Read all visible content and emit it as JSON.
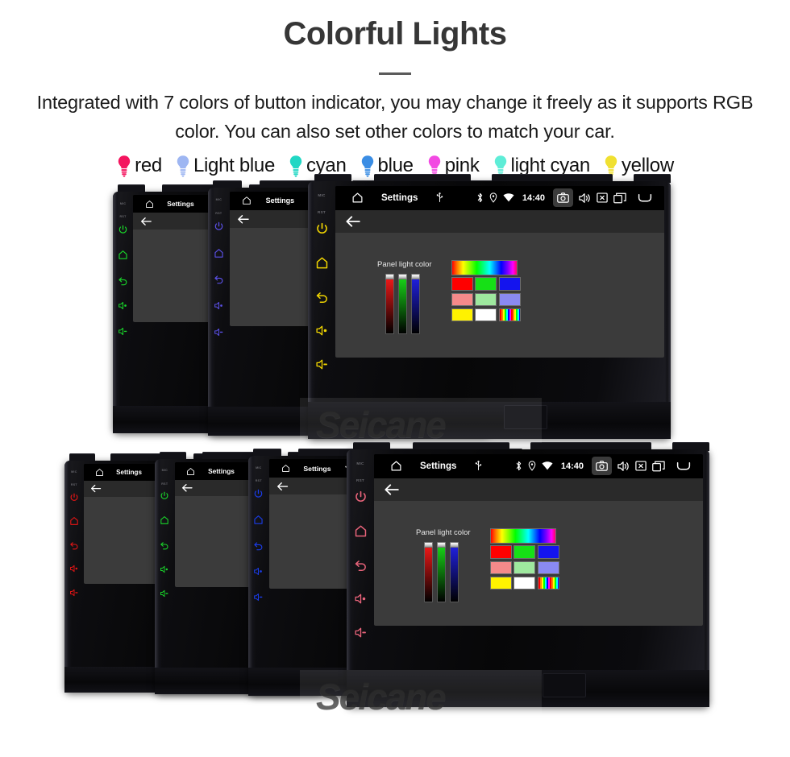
{
  "header": {
    "title": "Colorful Lights",
    "subtitle": "Integrated with 7 colors of button indicator, you may change it freely as it supports RGB color. You can also set other colors to match your car."
  },
  "legend": {
    "items": [
      {
        "label": "red",
        "color": "#F4145E"
      },
      {
        "label": "Light blue",
        "color": "#9EB6F2"
      },
      {
        "label": "cyan",
        "color": "#21D7C4"
      },
      {
        "label": "blue",
        "color": "#3A8DE4"
      },
      {
        "label": "pink",
        "color": "#F249E2"
      },
      {
        "label": "light cyan",
        "color": "#5EEDD7"
      },
      {
        "label": "yellow",
        "color": "#F0E031"
      }
    ]
  },
  "device": {
    "rail": {
      "mic_label": "MIC",
      "rst_label": "RST",
      "buttons": [
        {
          "name": "power",
          "icon": "power-icon"
        },
        {
          "name": "home",
          "icon": "home-icon"
        },
        {
          "name": "back",
          "icon": "back-icon"
        },
        {
          "name": "volume-up",
          "icon": "volume-up-icon"
        },
        {
          "name": "volume-down",
          "icon": "volume-down-icon"
        }
      ]
    },
    "statusbar": {
      "title": "Settings",
      "time": "14:40",
      "icons_left": [
        "home-icon",
        "usb-icon"
      ],
      "icons_right": [
        "bluetooth-icon",
        "location-icon",
        "wifi-icon",
        "camera-icon",
        "volume-icon",
        "close-box-icon",
        "recent-apps-icon",
        "back-arrow-icon"
      ]
    },
    "actionbar": {
      "back_label": "back-arrow-icon"
    },
    "panel_dialog": {
      "label": "Panel light color",
      "sliders": [
        {
          "name": "red-slider",
          "color": "#ff1a1a",
          "value": 100
        },
        {
          "name": "green-slider",
          "color": "#19e019",
          "value": 100
        },
        {
          "name": "blue-slider",
          "color": "#2222ee",
          "value": 100
        }
      ],
      "hue_bar": "hue-gradient",
      "swatches": [
        [
          "#FF0000",
          "#16E016",
          "#1414EE"
        ],
        [
          "#F58A8A",
          "#9EE89E",
          "#8A8AF2"
        ],
        [
          "#FFF200",
          "#FFFFFF",
          "rainbow"
        ]
      ]
    },
    "watermark": "Seicane"
  },
  "groups": {
    "top": {
      "units": [
        {
          "name": "unit-green",
          "led": "#19D62A"
        },
        {
          "name": "unit-indigo",
          "led": "#5B50E8"
        },
        {
          "name": "unit-yellow",
          "led": "#F2D600",
          "front": true
        }
      ]
    },
    "bottom": {
      "units": [
        {
          "name": "unit-red",
          "led": "#E81515"
        },
        {
          "name": "unit-green",
          "led": "#19D62A"
        },
        {
          "name": "unit-blue",
          "led": "#1A3CE8"
        },
        {
          "name": "unit-pink",
          "led": "#E8637A",
          "front": true
        }
      ]
    }
  }
}
